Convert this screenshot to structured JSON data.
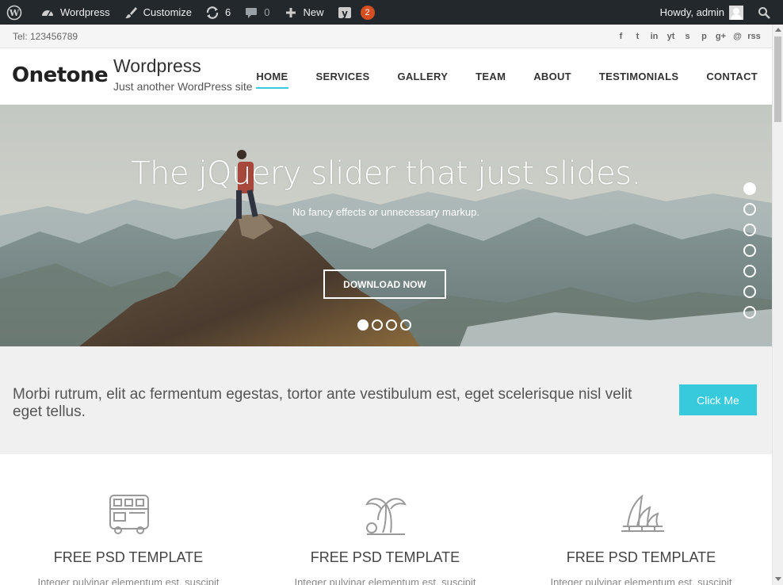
{
  "adminbar": {
    "items": [
      {
        "icon": "wordpress-logo-icon",
        "label": ""
      },
      {
        "icon": "dashboard-icon",
        "label": "Wordpress"
      },
      {
        "icon": "paintbrush-icon",
        "label": "Customize"
      },
      {
        "icon": "updates-icon",
        "label": "6"
      },
      {
        "icon": "comments-icon",
        "label": "0"
      },
      {
        "icon": "plus-icon",
        "label": "New"
      },
      {
        "icon": "yoast-icon",
        "label": "2"
      }
    ],
    "greeting": "Howdy, admin",
    "badge_color": "#d54e21"
  },
  "infobar": {
    "tel": "Tel: 123456789",
    "social": [
      "f",
      "t",
      "in",
      "yt",
      "s",
      "p",
      "g+",
      "@",
      "rss"
    ]
  },
  "header": {
    "logo": "Onetone",
    "site_title": "Wordpress",
    "tagline": "Just another WordPress site",
    "nav": [
      "HOME",
      "SERVICES",
      "GALLERY",
      "TEAM",
      "ABOUT",
      "TESTIMONIALS",
      "CONTACT"
    ],
    "accent": "#37cadd"
  },
  "slider": {
    "title": "The jQuery slider that just slides.",
    "subtitle": "No fancy effects or unnecessary markup.",
    "button": "DOWNLOAD NOW",
    "active_dot": 1,
    "dot_count": 4,
    "side_dot_count": 7,
    "side_active": 1
  },
  "callout": {
    "text": "Morbi rutrum, elit ac fermentum egestas, tortor ante vestibulum est, eget scelerisque nisl velit eget tellus.",
    "button": "Click Me"
  },
  "features": [
    {
      "icon": "double-decker-bus-icon",
      "title": "FREE PSD TEMPLATE",
      "desc": "Integer pulvinar elementum est, suscipit"
    },
    {
      "icon": "palm-tree-icon",
      "title": "FREE PSD TEMPLATE",
      "desc": "Integer pulvinar elementum est, suscipit"
    },
    {
      "icon": "sydney-opera-house-icon",
      "title": "FREE PSD TEMPLATE",
      "desc": "Integer pulvinar elementum est, suscipit"
    }
  ]
}
